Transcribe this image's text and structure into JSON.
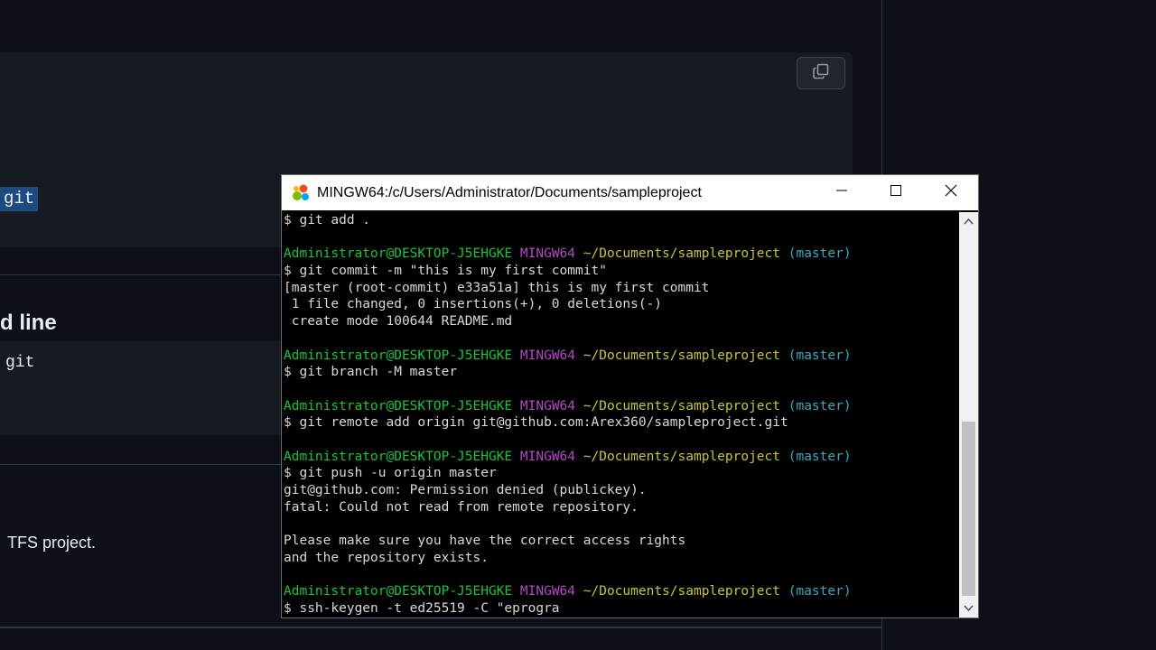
{
  "background_page": {
    "selected_code": "git",
    "heading": "d line",
    "code_text": "git",
    "paragraph_text": "TFS project."
  },
  "terminal": {
    "title": "MINGW64:/c/Users/Administrator/Documents/sampleproject",
    "colors": {
      "user_host": "#1ec33c",
      "system": "#b548c6",
      "path": "#c7c43b",
      "branch": "#3ba8bf",
      "text": "#d8d8d8"
    },
    "lines": [
      {
        "type": "cmd",
        "text": "$ git add ."
      },
      {
        "type": "blank",
        "text": ""
      },
      {
        "type": "prompt",
        "user": "Administrator@DESKTOP-J5EHGKE",
        "sys": "MINGW64",
        "path": "~/Documents/sampleproject",
        "branch": "(master)"
      },
      {
        "type": "cmd",
        "text": "$ git commit -m \"this is my first commit\""
      },
      {
        "type": "out",
        "text": "[master (root-commit) e33a51a] this is my first commit"
      },
      {
        "type": "out",
        "text": " 1 file changed, 0 insertions(+), 0 deletions(-)"
      },
      {
        "type": "out",
        "text": " create mode 100644 README.md"
      },
      {
        "type": "blank",
        "text": ""
      },
      {
        "type": "prompt",
        "user": "Administrator@DESKTOP-J5EHGKE",
        "sys": "MINGW64",
        "path": "~/Documents/sampleproject",
        "branch": "(master)"
      },
      {
        "type": "cmd",
        "text": "$ git branch -M master"
      },
      {
        "type": "blank",
        "text": ""
      },
      {
        "type": "prompt",
        "user": "Administrator@DESKTOP-J5EHGKE",
        "sys": "MINGW64",
        "path": "~/Documents/sampleproject",
        "branch": "(master)"
      },
      {
        "type": "cmd",
        "text": "$ git remote add origin git@github.com:Arex360/sampleproject.git"
      },
      {
        "type": "blank",
        "text": ""
      },
      {
        "type": "prompt",
        "user": "Administrator@DESKTOP-J5EHGKE",
        "sys": "MINGW64",
        "path": "~/Documents/sampleproject",
        "branch": "(master)"
      },
      {
        "type": "cmd",
        "text": "$ git push -u origin master"
      },
      {
        "type": "out",
        "text": "git@github.com: Permission denied (publickey)."
      },
      {
        "type": "out",
        "text": "fatal: Could not read from remote repository."
      },
      {
        "type": "blank",
        "text": ""
      },
      {
        "type": "out",
        "text": "Please make sure you have the correct access rights"
      },
      {
        "type": "out",
        "text": "and the repository exists."
      },
      {
        "type": "blank",
        "text": ""
      },
      {
        "type": "prompt",
        "user": "Administrator@DESKTOP-J5EHGKE",
        "sys": "MINGW64",
        "path": "~/Documents/sampleproject",
        "branch": "(master)"
      },
      {
        "type": "cmd",
        "text": "$ ssh-keygen -t ed25519 -C \"eprogra"
      }
    ]
  }
}
